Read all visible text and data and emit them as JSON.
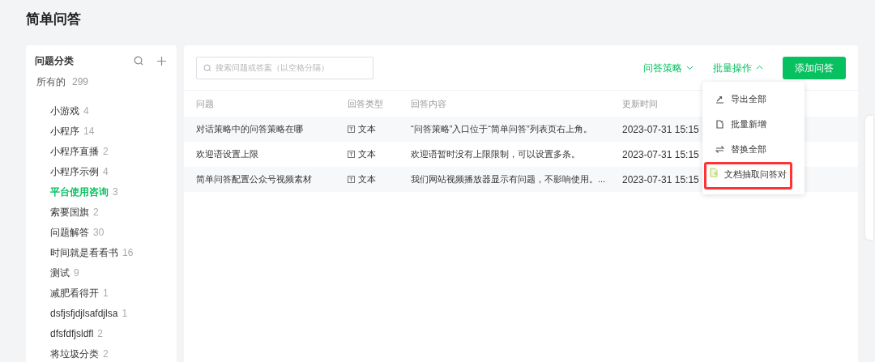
{
  "page_title": "简单问答",
  "sidebar": {
    "title": "问题分类",
    "all": {
      "label": "所有的",
      "count": "299"
    },
    "items": [
      {
        "label": "小游戏",
        "count": "4",
        "selected": false
      },
      {
        "label": "小程序",
        "count": "14",
        "selected": false
      },
      {
        "label": "小程序直播",
        "count": "2",
        "selected": false
      },
      {
        "label": "小程序示例",
        "count": "4",
        "selected": false
      },
      {
        "label": "平台使用咨询",
        "count": "3",
        "selected": true
      },
      {
        "label": "索要国旗",
        "count": "2",
        "selected": false
      },
      {
        "label": "问题解答",
        "count": "30",
        "selected": false
      },
      {
        "label": "时间就是看看书",
        "count": "16",
        "selected": false
      },
      {
        "label": "测试",
        "count": "9",
        "selected": false
      },
      {
        "label": "减肥看得开",
        "count": "1",
        "selected": false
      },
      {
        "label": "dsfjsfjdjlsafdjlsa",
        "count": "1",
        "selected": false
      },
      {
        "label": "dfsfdfjsldfl",
        "count": "2",
        "selected": false
      },
      {
        "label": "将垃圾分类",
        "count": "2",
        "selected": false
      }
    ]
  },
  "search": {
    "placeholder": "搜索问题或答案（以空格分隔）"
  },
  "toolbar": {
    "dropdowns": [
      {
        "label": "问答策略",
        "expanded": false
      },
      {
        "label": "批量操作",
        "expanded": true
      }
    ],
    "add_button": "添加问答"
  },
  "menu": [
    {
      "kind": "export",
      "label": "导出全部",
      "highlighted": false
    },
    {
      "kind": "import",
      "label": "批量新增",
      "highlighted": false
    },
    {
      "kind": "replace",
      "label": "替换全部",
      "highlighted": false
    },
    {
      "kind": "document",
      "label": "文档抽取问答对",
      "highlighted": true
    }
  ],
  "table": {
    "columns": [
      "问题",
      "回答类型",
      "回答内容",
      "更新时间"
    ],
    "rows": [
      {
        "question": "对话策略中的问答策略在哪",
        "type": "文本",
        "answer": "“问答策略”入口位于“简单问答”列表页右上角。",
        "time": "2023-07-31 15:15"
      },
      {
        "question": "欢迎语设置上限",
        "type": "文本",
        "answer": "欢迎语暂时没有上限限制，可以设置多条。",
        "time": "2023-07-31 15:15"
      },
      {
        "question": "简单问答配置公众号视频素材",
        "type": "文本",
        "answer": "我们网站视频播放器显示有问题，不影响使用。...",
        "time": "2023-07-31 15:15"
      }
    ]
  }
}
